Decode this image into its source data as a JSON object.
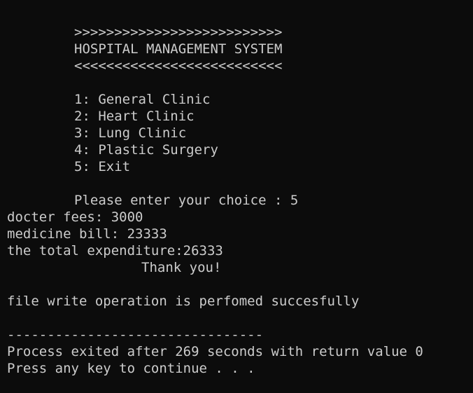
{
  "console": {
    "banner_top": ">>>>>>>>>>>>>>>>>>>>>>>>>>",
    "title": "HOSPITAL MANAGEMENT SYSTEM",
    "banner_bottom": "<<<<<<<<<<<<<<<<<<<<<<<<<<",
    "menu": [
      "1: General Clinic",
      "2: Heart Clinic",
      "3: Lung Clinic",
      "4: Plastic Surgery",
      "5: Exit"
    ],
    "prompt": "Please enter your choice : 5",
    "doctor_fees": "docter fees: 3000",
    "medicine_bill": "medicine bill: 23333",
    "total": "the total expenditure:26333",
    "thanks": "Thank you!",
    "file_message": "file write operation is perfomed succesfully",
    "separator": "--------------------------------",
    "process_exit": "Process exited after 269 seconds with return value 0",
    "press_key": "Press any key to continue . . ."
  }
}
